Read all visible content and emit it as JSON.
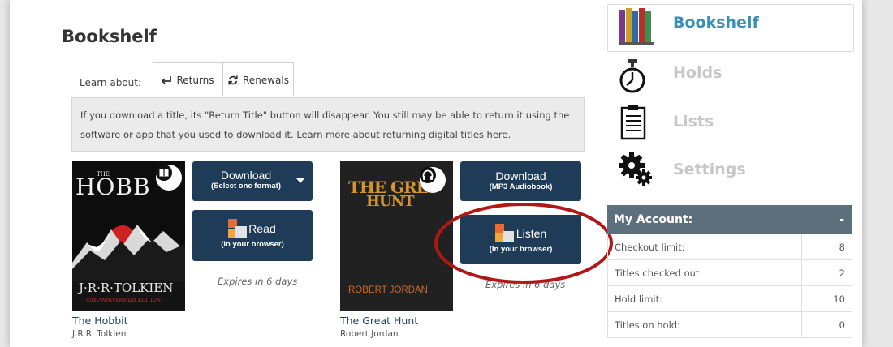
{
  "page": {
    "title": "Bookshelf"
  },
  "learn": {
    "label": "Learn about:",
    "tabs": [
      {
        "label": "Returns"
      },
      {
        "label": "Renewals"
      }
    ]
  },
  "info": {
    "text": "If you download a title, its \"Return Title\" button will disappear. You still may be able to return it using the software or app that you used to download it. Learn more about returning digital titles here."
  },
  "books": [
    {
      "title": "The Hobbit",
      "author": "J.R.R. Tolkien",
      "cover": {
        "top": "THE",
        "title": "HOBB",
        "author": "J·R·R·TOLKIEN",
        "edition": "75th ANNIVERSARY EDITION"
      },
      "format_icon": "book-icon",
      "download": {
        "main": "Download",
        "sub": "(Select one format)"
      },
      "action": {
        "main": "Read",
        "sub": "(In your browser)"
      },
      "expires": "Expires in 6 days"
    },
    {
      "title": "The Great Hunt",
      "author": "Robert Jordan",
      "cover": {
        "title_line1": "THE GRE",
        "title_line2": "HUNT",
        "author": "ROBERT JORDAN"
      },
      "format_icon": "headphones-icon",
      "download": {
        "main": "Download",
        "sub": "(MP3 Audiobook)"
      },
      "action": {
        "main": "Listen",
        "sub": "(In your browser)"
      },
      "expires": "Expires in 6 days"
    }
  ],
  "nav": [
    {
      "label": "Bookshelf",
      "icon": "bookshelf-icon",
      "active": true
    },
    {
      "label": "Holds",
      "icon": "stopwatch-icon"
    },
    {
      "label": "Lists",
      "icon": "list-icon"
    },
    {
      "label": "Settings",
      "icon": "gear-icon"
    }
  ],
  "account": {
    "title": "My Account:",
    "collapse": "-",
    "rows": [
      {
        "label": "Checkout limit:",
        "value": "8"
      },
      {
        "label": "Titles checked out:",
        "value": "2"
      },
      {
        "label": "Hold limit:",
        "value": "10"
      },
      {
        "label": "Titles on hold:",
        "value": "0"
      }
    ]
  },
  "colors": {
    "button": "#1e3c57",
    "accent": "#3a8fb7",
    "nav_inactive": "#c7c7c7",
    "account_header": "#5d6f7d",
    "annotation": "#b01818"
  }
}
